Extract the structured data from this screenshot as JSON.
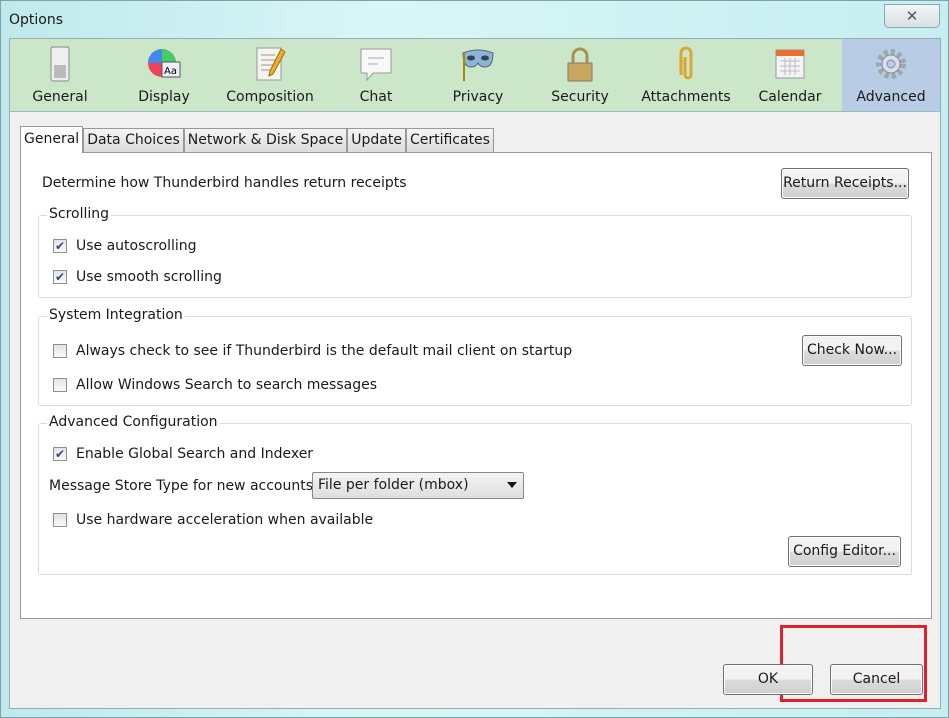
{
  "window": {
    "title": "Options",
    "close_icon": "close-icon"
  },
  "toolbar": {
    "items": [
      {
        "label": "General",
        "icon": "switch-icon"
      },
      {
        "label": "Display",
        "icon": "display-icon"
      },
      {
        "label": "Composition",
        "icon": "composition-icon"
      },
      {
        "label": "Chat",
        "icon": "chat-icon"
      },
      {
        "label": "Privacy",
        "icon": "mask-icon"
      },
      {
        "label": "Security",
        "icon": "lock-icon"
      },
      {
        "label": "Attachments",
        "icon": "paperclip-icon"
      },
      {
        "label": "Calendar",
        "icon": "calendar-icon"
      },
      {
        "label": "Advanced",
        "icon": "gear-icon",
        "selected": true
      }
    ]
  },
  "tabs": [
    "General",
    "Data Choices",
    "Network & Disk Space",
    "Update",
    "Certificates"
  ],
  "receipts": {
    "text": "Determine how Thunderbird handles return receipts",
    "button": "Return Receipts..."
  },
  "scrolling": {
    "label": "Scrolling",
    "autoscroll": "Use autoscrolling",
    "smooth": "Use smooth scrolling"
  },
  "system": {
    "label": "System Integration",
    "default_check": "Always check to see if Thunderbird is the default mail client on startup",
    "check_now": "Check Now...",
    "windows_search": "Allow Windows Search to search messages"
  },
  "advanced": {
    "label": "Advanced Configuration",
    "global_search": "Enable Global Search and Indexer",
    "store_label": "Message Store Type for new accounts:",
    "store_value": "File per folder (mbox)",
    "hw_accel": "Use hardware acceleration when available",
    "config_editor": "Config Editor..."
  },
  "footer": {
    "ok": "OK",
    "cancel": "Cancel"
  },
  "colors": {
    "highlight": "#e0202a",
    "toolbar_bg": "#cce6c9",
    "selected_bg": "#b9cce6"
  }
}
